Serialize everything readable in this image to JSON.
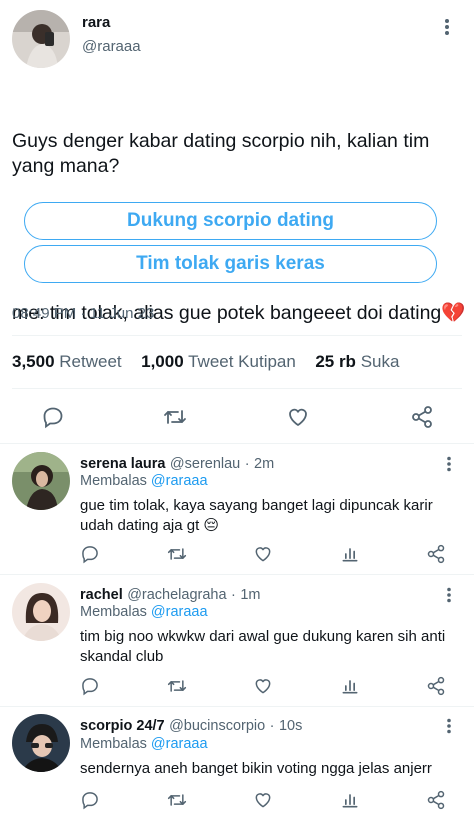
{
  "tweet": {
    "author_name": "rara",
    "author_handle": "@raraaa",
    "text_line1": "Guys denger kabar dating scorpio nih, kalian tim yang mana?",
    "text_line2": "me: tim tolak, alias gue potek bangeeet doi dating💔",
    "poll": [
      {
        "label": "Dukung scorpio dating"
      },
      {
        "label": "Tim tolak garis keras"
      }
    ],
    "time": "08:49 PM",
    "separator": "·",
    "date": "11 Jun 23",
    "retweets_count": "3,500",
    "retweets_label": "Retweet",
    "quotes_count": "1,000",
    "quotes_label": "Tweet Kutipan",
    "likes_count": "25 rb",
    "likes_label": "Suka"
  },
  "replying_label": "Membalas",
  "replies": [
    {
      "name": "serena laura",
      "handle": "@serenlau",
      "sep": "·",
      "time": "2m",
      "reply_to": "@raraaa",
      "text": "gue tim tolak, kaya sayang banget lagi dipuncak karir udah dating aja gt 😔"
    },
    {
      "name": "rachel",
      "handle": "@rachelagraha",
      "sep": "·",
      "time": "1m",
      "reply_to": "@raraaa",
      "text": "tim big noo wkwkw dari awal gue dukung karen sih anti skandal club"
    },
    {
      "name": "scorpio 24/7",
      "handle": "@bucinscorpio",
      "sep": "·",
      "time": "10s",
      "reply_to": "@raraaa",
      "text": "sendernya aneh banget bikin voting ngga jelas anjerr"
    }
  ],
  "colors": {
    "accent": "#1d9bf0",
    "text_primary": "#0f1419",
    "text_secondary": "#536471",
    "divider": "#eff3f4"
  }
}
